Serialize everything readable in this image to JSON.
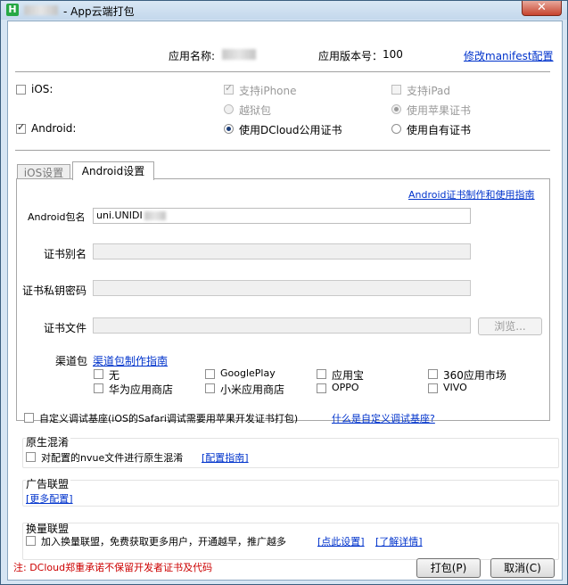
{
  "window": {
    "icon_letter": "H",
    "title": "- App云端打包",
    "close_glyph": "✕"
  },
  "header": {
    "app_name_label": "应用名称:",
    "app_version_label": "应用版本号：",
    "app_version_value": "100",
    "edit_manifest_link": "修改manifest配置"
  },
  "platforms": {
    "ios_label": "iOS:",
    "ios_checked": false,
    "support_iphone": "支持iPhone",
    "support_ipad": "支持iPad",
    "jailbreak": "越狱包",
    "use_apple_cert": "使用苹果证书",
    "android_label": "Android:",
    "android_checked": true,
    "use_dcloud_cert": "使用DCloud公用证书",
    "use_own_cert": "使用自有证书"
  },
  "tabs": {
    "ios_tab": "iOS设置",
    "android_tab": "Android设置",
    "active": "Android设置"
  },
  "android": {
    "cert_guide_link": "Android证书制作和使用指南",
    "package_label": "Android包名",
    "package_value": "uni.UNIDI",
    "cert_alias_label": "证书别名",
    "cert_password_label": "证书私钥密码",
    "cert_file_label": "证书文件",
    "browse_button": "浏览...",
    "channel_label": "渠道包",
    "channel_guide_link": "渠道包制作指南",
    "channels": [
      "无",
      "GooglePlay",
      "应用宝",
      "360应用市场",
      "华为应用商店",
      "小米应用商店",
      "OPPO",
      "VIVO"
    ]
  },
  "custom_base": {
    "label": "自定义调试基座(iOS的Safari调试需要用苹果开发证书打包)",
    "link": "什么是自定义调试基座?"
  },
  "native_obfuscation": {
    "title": "原生混淆",
    "option": "对配置的nvue文件进行原生混淆",
    "link": "[配置指南]"
  },
  "ad_alliance": {
    "title": "广告联盟",
    "link": "[更多配置]"
  },
  "exchange_alliance": {
    "title": "换量联盟",
    "option": "加入换量联盟，免费获取更多用户，开通越早，推广越多",
    "link1": "[点此设置]",
    "link2": "[了解详情]"
  },
  "footer": {
    "notice": "注: DCloud郑重承诺不保留开发者证书及代码",
    "notice_color": "#cc0000",
    "pack_button": "打包(P)",
    "cancel_button": "取消(C)"
  }
}
